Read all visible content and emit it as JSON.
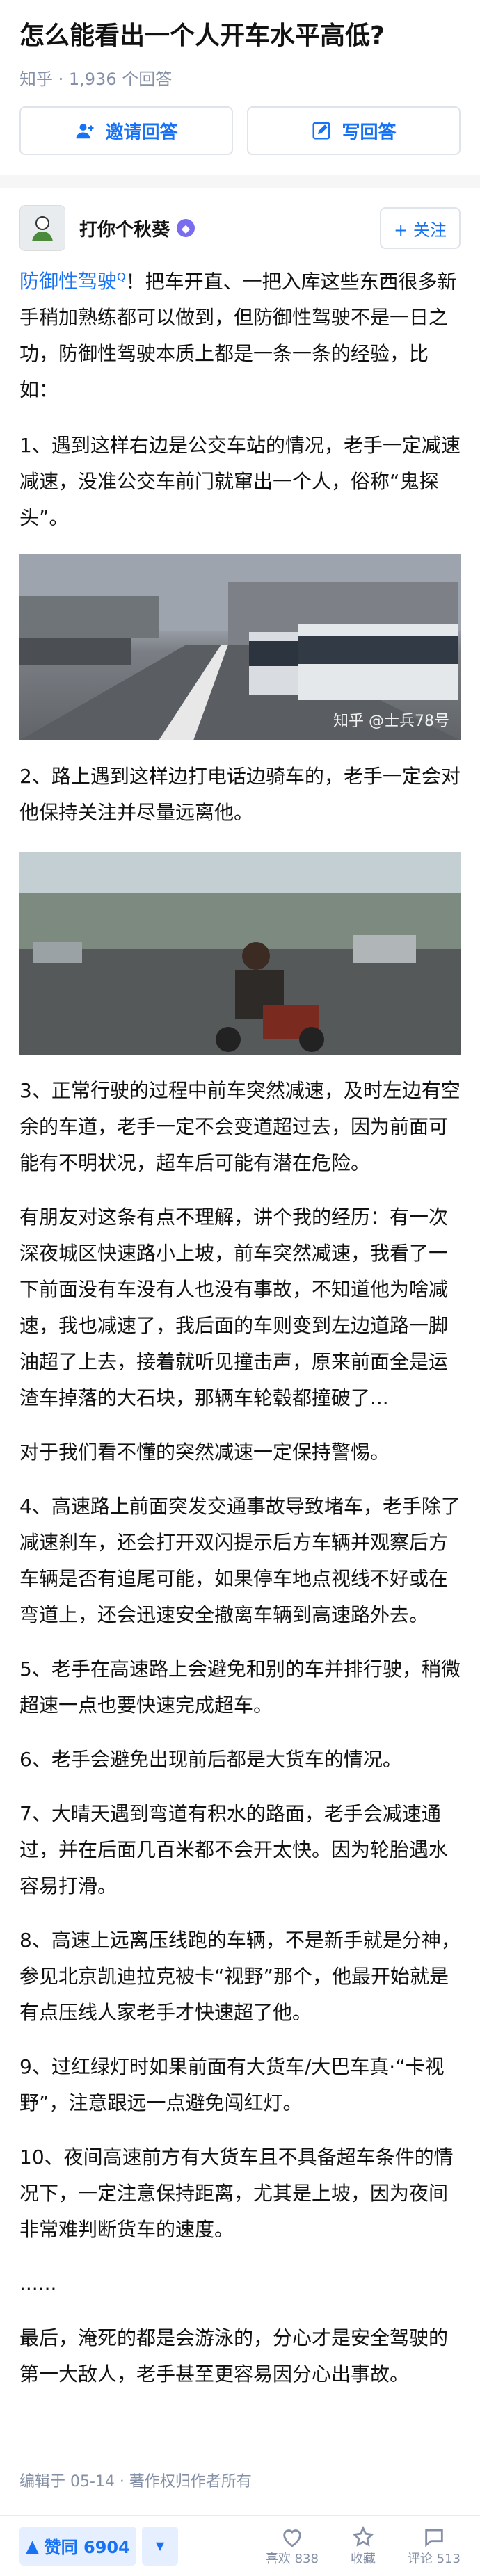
{
  "question": {
    "title": "怎么能看出一个人开车水平高低?",
    "meta": "知乎 · 1,936 个回答",
    "invite_label": "邀请回答",
    "write_label": "写回答"
  },
  "author": {
    "name": "打你个秋葵",
    "follow_label": "+ 关注"
  },
  "answer": {
    "p1_link": "防御性驾驶",
    "p1_rest": "！把车开直、一把入库这些东西很多新手稍加熟练都可以做到，但防御性驾驶不是一日之功，防御性驾驶本质上都是一条一条的经验，比如：",
    "p2": "1、遇到这样右边是公交车站的情况，老手一定减速减速，没准公交车前门就窜出一个人，俗称“鬼探头”。",
    "img1_watermark": "知乎 @士兵78号",
    "p3": "2、路上遇到这样边打电话边骑车的，老手一定会对他保持关注并尽量远离他。",
    "p4": "3、正常行驶的过程中前车突然减速，及时左边有空余的车道，老手一定不会变道超过去，因为前面可能有不明状况，超车后可能有潜在危险。",
    "p5": "有朋友对这条有点不理解，讲个我的经历：有一次深夜城区快速路小上坡，前车突然减速，我看了一下前面没有车没有人也没有事故，不知道他为啥减速，我也减速了，我后面的车则变到左边道路一脚油超了上去，接着就听见撞击声，原来前面全是运渣车掉落的大石块，那辆车轮毂都撞破了...",
    "p6": "对于我们看不懂的突然减速一定保持警惕。",
    "p7": "4、高速路上前面突发交通事故导致堵车，老手除了减速刹车，还会打开双闪提示后方车辆并观察后方车辆是否有追尾可能，如果停车地点视线不好或在弯道上，还会迅速安全撤离车辆到高速路外去。",
    "p8": "5、老手在高速路上会避免和别的车并排行驶，稍微超速一点也要快速完成超车。",
    "p9": "6、老手会避免出现前后都是大货车的情况。",
    "p10": "7、大晴天遇到弯道有积水的路面，老手会减速通过，并在后面几百米都不会开太快。因为轮胎遇水容易打滑。",
    "p11": "8、高速上远离压线跑的车辆，不是新手就是分神，参见北京凯迪拉克被卡“视野”那个，他最开始就是有点压线人家老手才快速超了他。",
    "p12": "9、过红绿灯时如果前面有大货车/大巴车真·“卡视野”，注意跟远一点避免闯红灯。",
    "p13": "10、夜间高速前方有大货车且不具备超车条件的情况下，一定注意保持距离，尤其是上坡，因为夜间非常难判断货车的速度。",
    "p14": "......",
    "p15": "最后，淹死的都是会游泳的，分心才是安全驾驶的第一大敌人，老手甚至更容易因分心出事故。"
  },
  "footer": {
    "edited": "编辑于 05-14 · 著作权归作者所有",
    "vote_label": "赞同 6904",
    "like_label": "喜欢 838",
    "collect_label": "收藏",
    "comment_label": "评论 513"
  },
  "colors": {
    "accent": "#1772f6",
    "meta": "#8590a6"
  }
}
